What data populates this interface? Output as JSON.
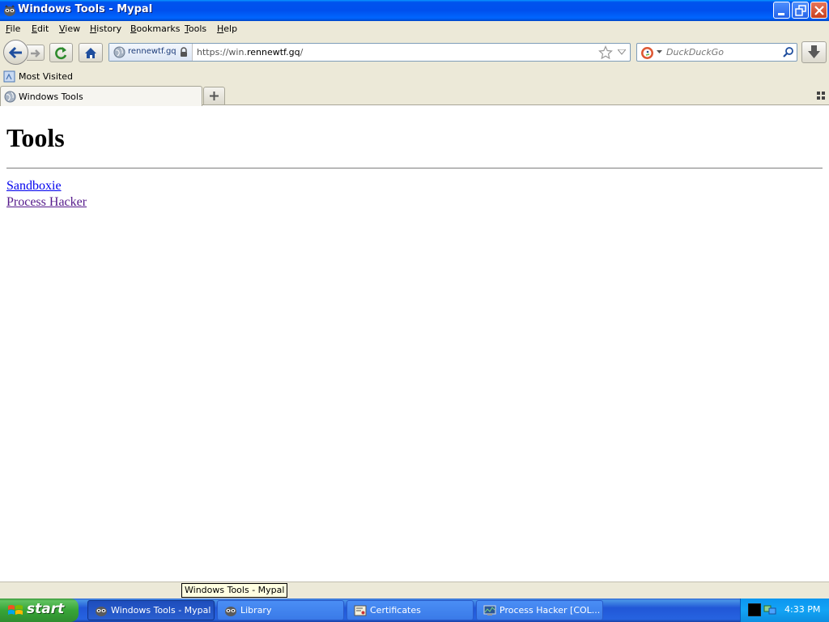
{
  "window": {
    "title": "Windows Tools - Mypal"
  },
  "menu": [
    "File",
    "Edit",
    "View",
    "History",
    "Bookmarks",
    "Tools",
    "Help"
  ],
  "navbar": {
    "site_identity": "rennewtf.gq",
    "url_prefix": "https://win.",
    "url_domain": "rennewtf.gq",
    "url_suffix": "/",
    "search_placeholder": "DuckDuckGo"
  },
  "bookmarks": {
    "most_visited": "Most Visited"
  },
  "tabs": [
    {
      "label": "Windows Tools",
      "active": true
    }
  ],
  "page": {
    "heading": "Tools",
    "links": [
      {
        "label": "Sandboxie",
        "visited": false
      },
      {
        "label": "Process Hacker",
        "visited": true
      }
    ]
  },
  "status": {
    "tooltip": "Windows Tools - Mypal"
  },
  "taskbar": {
    "start_label": "start",
    "tasks": [
      {
        "label": "Windows Tools - Mypal",
        "icon": "mypal-icon",
        "active": true
      },
      {
        "label": "Library",
        "icon": "mypal-icon",
        "active": false
      },
      {
        "label": "Certificates",
        "icon": "certificates-icon",
        "active": false
      },
      {
        "label": "Process Hacker [COL...",
        "icon": "process-hacker-icon",
        "active": false
      }
    ],
    "clock": "4:33 PM"
  },
  "colors": {
    "link": "#0000ee",
    "visited_link": "#551a8b",
    "titlebar": "#0054e3",
    "taskbar": "#245edb",
    "start_button": "#3c9a3c"
  }
}
